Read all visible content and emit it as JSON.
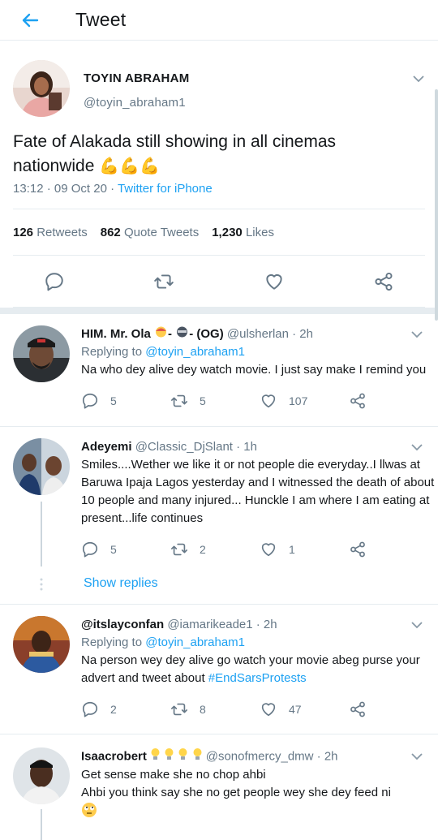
{
  "header": {
    "title": "Tweet",
    "back_icon": "arrow-left-icon"
  },
  "main_tweet": {
    "name": "TOYIN ABRAHAM",
    "handle": "@toyin_abraham1",
    "text": "Fate of Alakada still showing in all cinemas nationwide",
    "emoji": "💪💪💪",
    "time": "13:12 · 09 Oct 20 · ",
    "source": "Twitter for iPhone",
    "stats": {
      "retweets_count": "126",
      "retweets_label": "Retweets",
      "quotes_count": "862",
      "quotes_label": "Quote Tweets",
      "likes_count": "1,230",
      "likes_label": "Likes"
    }
  },
  "replies": [
    {
      "name": "HIM. Mr. Ola",
      "name_suffix": "- (OG)",
      "handle": "@ulsherlan · 2h",
      "replying_label": "Replying to ",
      "replying_to": "@toyin_abraham1",
      "text": "Na who dey alive dey watch movie. I just say make I remind you",
      "replies": "5",
      "retweets": "5",
      "likes": "107"
    },
    {
      "name": "Adeyemi",
      "handle": "@Classic_DjSlant · 1h",
      "text": "Smiles....Wether we like it or not people die everyday..I llwas at Baruwa Ipaja Lagos yesterday and I witnessed the death of about 10 people and many injured... Hunckle I am where I am eating at present...life continues",
      "replies": "5",
      "retweets": "2",
      "likes": "1",
      "show_replies": "Show replies"
    },
    {
      "name": "@itslayconfan",
      "handle": "@iamarikeade1 · 2h",
      "replying_label": "Replying to ",
      "replying_to": "@toyin_abraham1",
      "text": "Na person wey dey alive go watch your movie abeg purse your advert and tweet about ",
      "hashtag": "#EndSarsProtests",
      "replies": "2",
      "retweets": "8",
      "likes": "47"
    },
    {
      "name": "Isaacrobert",
      "handle": "@sonofmercy_dmw · 2h",
      "text_line1": "Get sense make she no chop ahbi",
      "text_line2": "Ahbi you think say she no get people wey she dey feed ni"
    }
  ],
  "colors": {
    "accent": "#1da1f2",
    "muted": "#657786",
    "divider": "#e6ecf0"
  }
}
